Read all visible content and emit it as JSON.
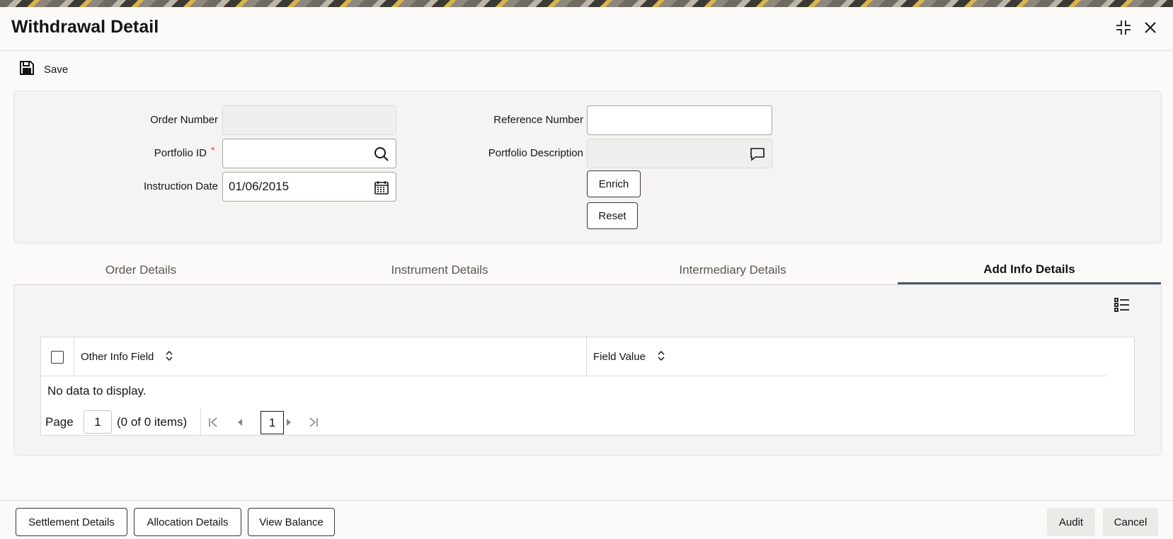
{
  "window": {
    "title": "Withdrawal Detail"
  },
  "toolbar": {
    "save_label": "Save"
  },
  "form": {
    "order_number": {
      "label": "Order Number",
      "value": ""
    },
    "portfolio_id": {
      "label": "Portfolio ID",
      "required_mark": "*",
      "value": ""
    },
    "instruction_date": {
      "label": "Instruction Date",
      "value": "01/06/2015"
    },
    "reference_number": {
      "label": "Reference Number",
      "value": ""
    },
    "portfolio_description": {
      "label": "Portfolio Description",
      "value": ""
    },
    "enrich_label": "Enrich",
    "reset_label": "Reset"
  },
  "tabs": [
    {
      "label": "Order Details",
      "active": false
    },
    {
      "label": "Instrument Details",
      "active": false
    },
    {
      "label": "Intermediary Details",
      "active": false
    },
    {
      "label": "Add Info Details",
      "active": true
    }
  ],
  "table": {
    "columns": [
      "Other Info Field",
      "Field Value"
    ],
    "empty_text": "No data to display.",
    "pager": {
      "page_label": "Page",
      "page_value": "1",
      "summary": "(0 of 0 items)",
      "current_page": "1"
    }
  },
  "footer": {
    "left_buttons": [
      "Settlement Details",
      "Allocation Details",
      "View Balance"
    ],
    "audit_label": "Audit",
    "cancel_label": "Cancel"
  },
  "icons": {
    "save": "save-icon",
    "maximize": "collapse-icon",
    "close": "close-icon",
    "search": "search-icon",
    "calendar": "calendar-icon",
    "comment": "comment-icon",
    "column_list": "column-list-icon",
    "sort": "sort-icon"
  }
}
